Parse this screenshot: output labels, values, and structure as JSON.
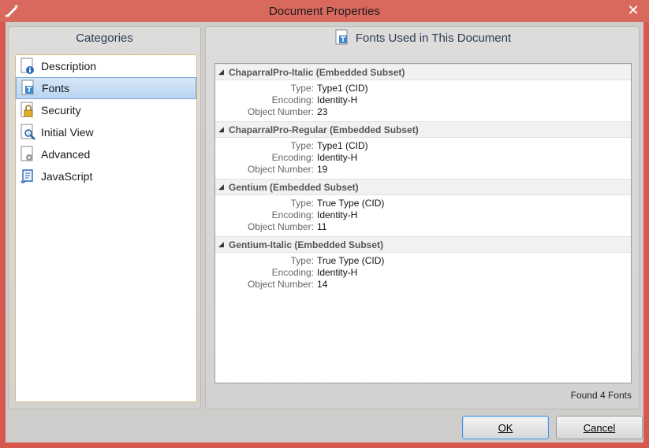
{
  "window": {
    "title": "Document Properties",
    "close_glyph": "✕"
  },
  "categories": {
    "header": "Categories",
    "items": [
      {
        "label": "Description",
        "icon": "info-doc-icon"
      },
      {
        "label": "Fonts",
        "icon": "font-doc-icon",
        "selected": true
      },
      {
        "label": "Security",
        "icon": "lock-doc-icon"
      },
      {
        "label": "Initial View",
        "icon": "magnifier-doc-icon"
      },
      {
        "label": "Advanced",
        "icon": "gear-doc-icon"
      },
      {
        "label": "JavaScript",
        "icon": "script-scroll-icon"
      }
    ]
  },
  "fonts_panel": {
    "header": "Fonts Used in This Document",
    "labels": {
      "type": "Type:",
      "encoding": "Encoding:",
      "object_number": "Object Number:"
    },
    "fonts": [
      {
        "name": "ChaparralPro-Italic (Embedded Subset)",
        "type": "Type1 (CID)",
        "encoding": "Identity-H",
        "object_number": "23"
      },
      {
        "name": "ChaparralPro-Regular (Embedded Subset)",
        "type": "Type1 (CID)",
        "encoding": "Identity-H",
        "object_number": "19"
      },
      {
        "name": "Gentium (Embedded Subset)",
        "type": "True Type (CID)",
        "encoding": "Identity-H",
        "object_number": "11"
      },
      {
        "name": "Gentium-Italic (Embedded Subset)",
        "type": "True Type (CID)",
        "encoding": "Identity-H",
        "object_number": "14"
      }
    ],
    "found_text": "Found 4 Fonts"
  },
  "buttons": {
    "ok": "OK",
    "cancel": "Cancel"
  },
  "colors": {
    "titlebar": "#d9685d",
    "selection": "#b9d5f1",
    "header_text": "#2b3c56"
  }
}
